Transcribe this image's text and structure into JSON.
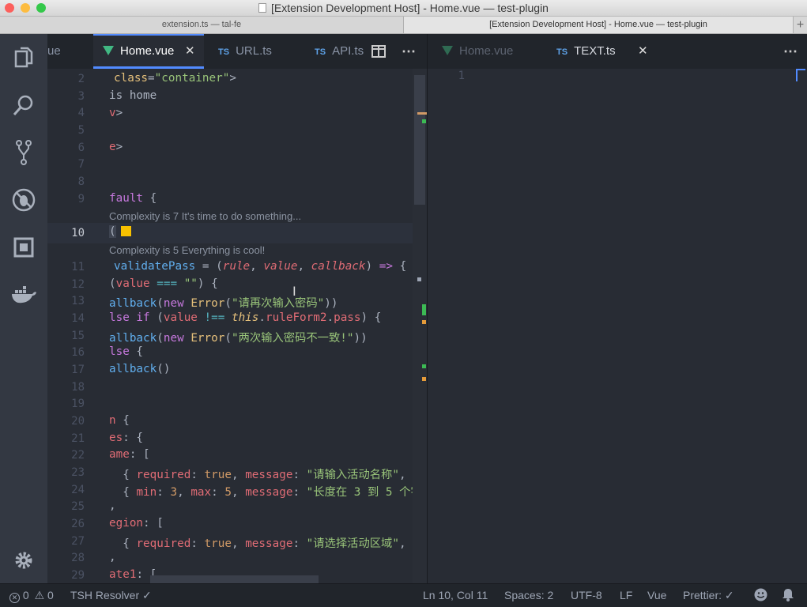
{
  "window": {
    "title": "[Extension Development Host] - Home.vue — test-plugin"
  },
  "window_tabs": [
    {
      "label": "extension.ts — tal-fe"
    },
    {
      "label": "[Extension Development Host] - Home.vue — test-plugin"
    }
  ],
  "activity_bar": [
    "files-icon",
    "search-icon",
    "source-control-icon",
    "debug-icon",
    "extensions-icon",
    "docker-icon",
    "gear-icon"
  ],
  "group1": {
    "tabs": [
      {
        "label": "ue",
        "type": "vue"
      },
      {
        "label": "Home.vue",
        "type": "vue",
        "active": true
      },
      {
        "label": "URL.ts",
        "type": "ts",
        "badge": "TS"
      },
      {
        "label": "API.ts",
        "type": "ts",
        "badge": "TS"
      }
    ],
    "lens_top": "Complexity is 7 It's time to do something...",
    "lens_bottom": "Complexity is 5 Everything is cool!"
  },
  "group2": {
    "tabs": [
      {
        "label": "Home.vue",
        "type": "vue"
      },
      {
        "label": "TEXT.ts",
        "type": "ts",
        "badge": "TS",
        "active": true
      }
    ],
    "line_number": "1"
  },
  "statusbar": {
    "errors": "0",
    "warnings": "0",
    "resolver": "TSH Resolver ✓",
    "position": "Ln 10, Col 11",
    "spaces": "Spaces: 2",
    "encoding": "UTF-8",
    "eol": "LF",
    "language": "Vue",
    "prettier": "Prettier: ✓"
  },
  "colors": {
    "accent": "#528bff",
    "vue_green": "#41b883",
    "ts_blue": "#5ea2e8",
    "complexity_ok": "#3cba54",
    "complexity_warn": "#f8c100"
  }
}
